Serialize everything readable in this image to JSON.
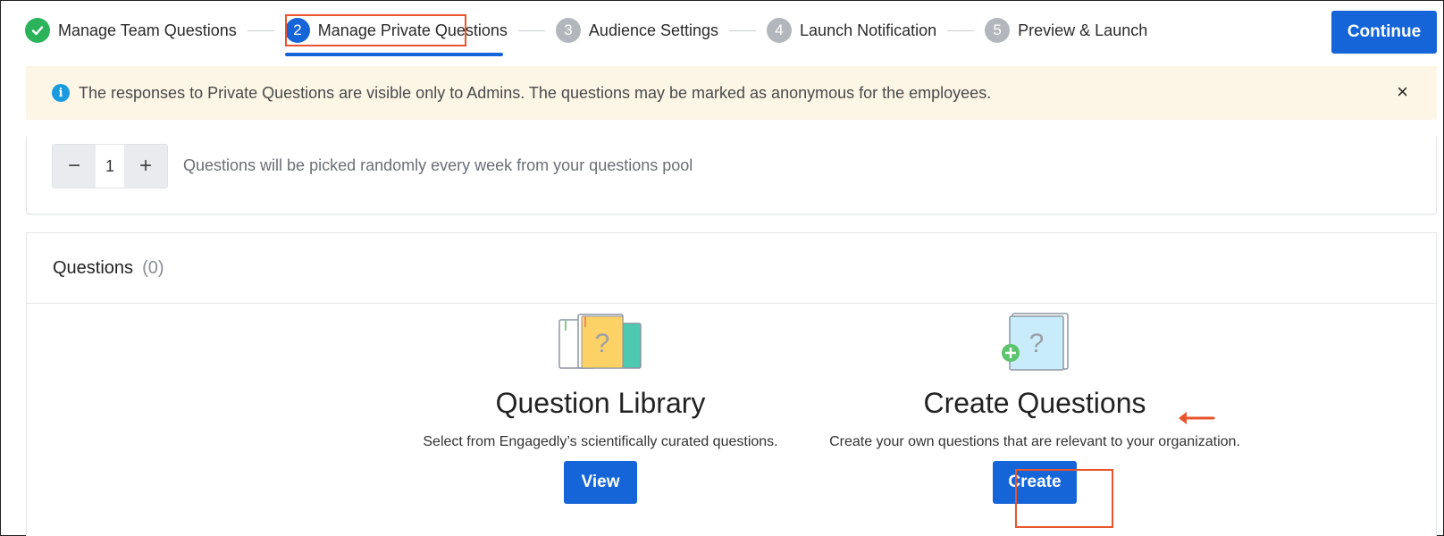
{
  "stepper": {
    "steps": [
      {
        "number": "✓",
        "label": "Manage Team Questions",
        "state": "done"
      },
      {
        "number": "2",
        "label": "Manage Private Questions",
        "state": "active"
      },
      {
        "number": "3",
        "label": "Audience Settings",
        "state": "pending"
      },
      {
        "number": "4",
        "label": "Launch Notification",
        "state": "pending"
      },
      {
        "number": "5",
        "label": "Preview & Launch",
        "state": "pending"
      }
    ],
    "continue_label": "Continue"
  },
  "banner": {
    "message": "The responses to Private Questions are visible only to Admins. The questions may be marked as anonymous for the employees.",
    "close_icon": "×"
  },
  "frequency": {
    "decrement": "−",
    "value": "1",
    "increment": "+",
    "description": "Questions will be picked randomly every week from your questions pool"
  },
  "questions": {
    "title": "Questions",
    "count": "(0)",
    "library": {
      "title": "Question Library",
      "description": "Select from Engagedly’s scientifically curated questions.",
      "button": "View"
    },
    "create": {
      "title": "Create Questions",
      "description": "Create your own questions that are relevant to your organization.",
      "button": "Create"
    }
  },
  "colors": {
    "primary": "#1565d8",
    "success": "#2ab35a",
    "highlight": "#e8542b",
    "banner_bg": "#fdf6e6"
  }
}
